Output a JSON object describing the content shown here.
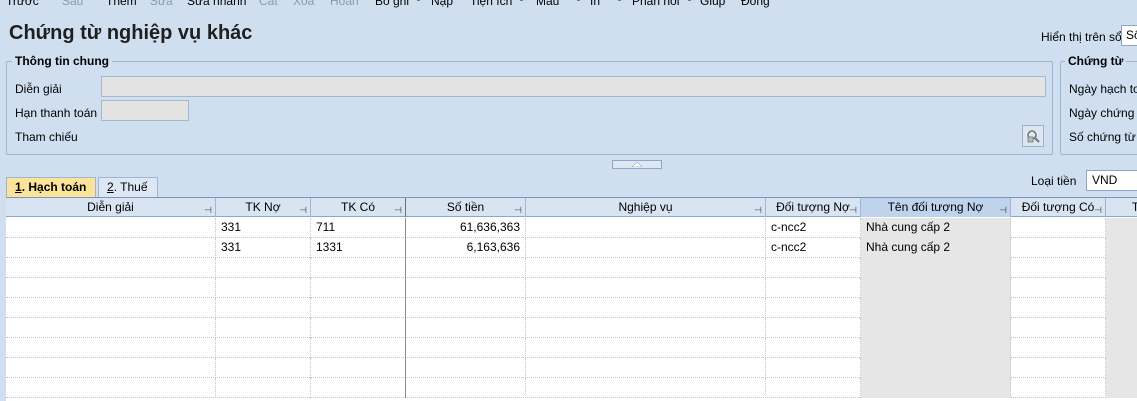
{
  "toolbar": {
    "items": [
      {
        "label": "Trước",
        "enabled": true
      },
      {
        "label": "Sau",
        "enabled": false
      },
      {
        "label": "Thêm",
        "enabled": true
      },
      {
        "label": "Sửa",
        "enabled": false
      },
      {
        "label": "Sửa nhanh",
        "enabled": true
      },
      {
        "label": "Cất",
        "enabled": false
      },
      {
        "label": "Xóa",
        "enabled": false
      },
      {
        "label": "Hoãn",
        "enabled": false
      },
      {
        "label": "Bỏ ghi",
        "enabled": true
      },
      {
        "label": "Nạp",
        "enabled": true
      },
      {
        "label": "Tiện ích",
        "enabled": true
      },
      {
        "label": "Mẫu",
        "enabled": true
      },
      {
        "label": "In",
        "enabled": true
      },
      {
        "label": "Phản hồi",
        "enabled": true
      },
      {
        "label": "Giúp",
        "enabled": true
      },
      {
        "label": "Đóng",
        "enabled": true
      }
    ]
  },
  "header": {
    "title": "Chứng từ nghiệp vụ khác",
    "display_label": "Hiển thị trên sổ",
    "display_value": "Sổ"
  },
  "general": {
    "legend": "Thông tin chung",
    "description_label": "Diễn giải",
    "description_value": "",
    "due_date_label": "Hạn thanh toán",
    "due_date_value": "",
    "reference_label": "Tham chiếu"
  },
  "voucher": {
    "legend": "Chứng từ",
    "posting_date_label": "Ngày hạch toán",
    "voucher_date_label": "Ngày chứng từ",
    "voucher_no_label": "Số chứng từ"
  },
  "tabs": [
    {
      "key": "1",
      "label": ". Hạch toán",
      "active": true
    },
    {
      "key": "2",
      "label": ". Thuế",
      "active": false
    }
  ],
  "currency": {
    "label": "Loại tiền",
    "value": "VND"
  },
  "grid": {
    "columns": [
      "Diễn giải",
      "TK Nợ",
      "TK Có",
      "Số tiền",
      "Nghiệp vụ",
      "Đối tượng Nợ",
      "Tên đối tượng Nợ",
      "Đối tượng Có",
      "T"
    ],
    "rows": [
      [
        "",
        "331",
        "711",
        "61,636,363",
        "",
        "c-ncc2",
        "Nhà cung cấp 2",
        "",
        ""
      ],
      [
        "",
        "331",
        "1331",
        "6,163,636",
        "",
        "c-ncc2",
        "Nhà cung cấp 2",
        "",
        ""
      ]
    ],
    "empty_rows": 7
  }
}
